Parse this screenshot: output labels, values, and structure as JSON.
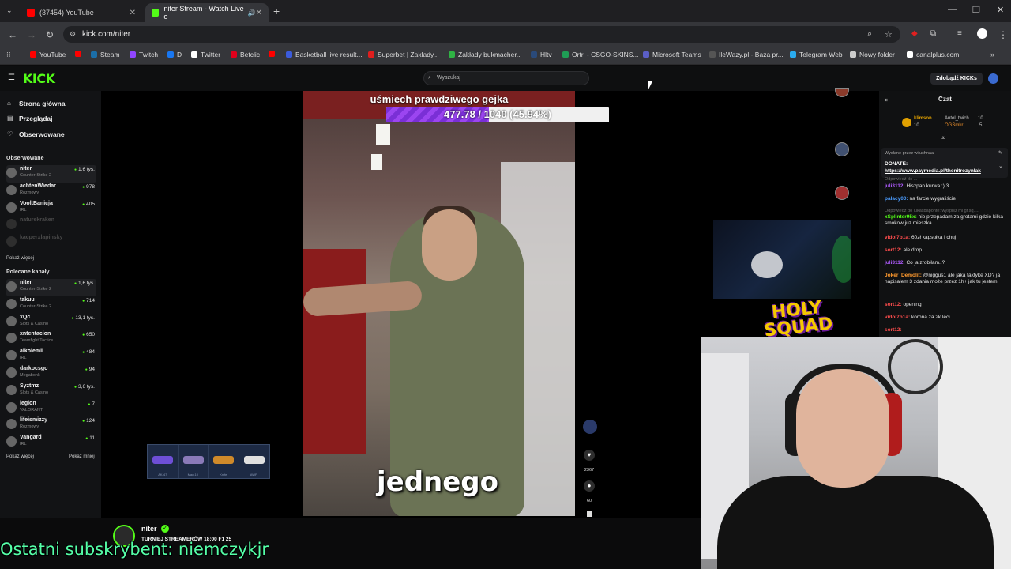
{
  "browser": {
    "tabs": [
      {
        "label": "(37454) YouTube",
        "color": "#ff0000"
      },
      {
        "label": "niter Stream - Watch Live o",
        "color": "#53fc18"
      }
    ],
    "url": "kick.com/niter",
    "bookmarks": [
      {
        "label": "YouTube",
        "color": "#ff0000"
      },
      {
        "label": "",
        "color": "#ff0000"
      },
      {
        "label": "Steam",
        "color": "#1b6ea8"
      },
      {
        "label": "Twitch",
        "color": "#9146ff"
      },
      {
        "label": "D",
        "color": "#1877f2"
      },
      {
        "label": "Twitter",
        "color": "#ffffff"
      },
      {
        "label": "Betclic",
        "color": "#e0001b"
      },
      {
        "label": "",
        "color": "#ff0000"
      },
      {
        "label": "Basketball live result...",
        "color": "#3b5bdb"
      },
      {
        "label": "Superbet | Zakłady...",
        "color": "#e01e1e"
      },
      {
        "label": "Zakłady bukmacher...",
        "color": "#2fb344"
      },
      {
        "label": "Hltv",
        "color": "#2a4a7a"
      },
      {
        "label": "Ortri - CSGO-SKINS...",
        "color": "#1f9d55"
      },
      {
        "label": "Microsoft Teams",
        "color": "#5b5fc7"
      },
      {
        "label": "IleWazy.pl - Baza pr...",
        "color": "#555555"
      },
      {
        "label": "Telegram Web",
        "color": "#2aabee"
      },
      {
        "label": "Nowy folder",
        "color": "#cccccc"
      },
      {
        "label": "canalplus.com",
        "color": "#ffffff"
      }
    ]
  },
  "kick": {
    "logo": "KICK",
    "search_placeholder": "Wyszukaj",
    "get_kicks": "Zdobądź KICKs"
  },
  "sidebar": {
    "nav": [
      "Strona główna",
      "Przeglądaj",
      "Obserwowane"
    ],
    "followed_header": "Obserwowane",
    "followed": [
      {
        "name": "niter",
        "category": "Counter-Strike 2",
        "viewers": "1,6 tys.",
        "selected": true,
        "online": true
      },
      {
        "name": "achtenWiedar",
        "category": "Rozmowy",
        "viewers": "978",
        "online": true
      },
      {
        "name": "VooltBanicja",
        "category": "IRL",
        "viewers": "405",
        "online": true
      },
      {
        "name": "naturekraken",
        "category": "",
        "viewers": "",
        "online": false
      },
      {
        "name": "kacperxlapinsky",
        "category": "",
        "viewers": "",
        "online": false
      }
    ],
    "show_more_1": "Pokaż więcej",
    "recommended_header": "Polecane kanały",
    "recommended": [
      {
        "name": "niter",
        "category": "Counter-Strike 2",
        "viewers": "1,6 tys.",
        "selected": true
      },
      {
        "name": "takuu",
        "category": "Counter-Strike 2",
        "viewers": "714"
      },
      {
        "name": "xQc",
        "category": "Slots & Casino",
        "viewers": "13,1 tys."
      },
      {
        "name": "xntentacion",
        "category": "Teamfight Tactics",
        "viewers": "650"
      },
      {
        "name": "alkoiemil",
        "category": "IRL",
        "viewers": "484"
      },
      {
        "name": "darkocsgo",
        "category": "Megabonk",
        "viewers": "94"
      },
      {
        "name": "Syztmz",
        "category": "Slots & Casino",
        "viewers": "3,6 tys."
      },
      {
        "name": "legion",
        "category": "VALORANT",
        "viewers": "7"
      },
      {
        "name": "lifeismizzy",
        "category": "Rozmowy",
        "viewers": "124"
      },
      {
        "name": "Vangard",
        "category": "IRL",
        "viewers": "11"
      }
    ],
    "show_more_2": "Pokaż więcej",
    "show_less": "Pokaż mniej"
  },
  "stream": {
    "goal_title": "uśmiech prawdziwego gejka",
    "goal_text": "477.78 / 1040 (45.94%)",
    "goal_fraction": 0.4594,
    "caption": "jednego",
    "likes": "2367",
    "comments": "60",
    "case_items": [
      {
        "label": "AK-47",
        "color": "#6e4fd6"
      },
      {
        "label": "Mac-10",
        "color": "#8a7ab8"
      },
      {
        "label": "Knife",
        "color": "#d08a2a"
      },
      {
        "label": "AWP",
        "color": "#e0e0e0"
      }
    ],
    "overlay_logo": "HOLY SQUAD"
  },
  "chat": {
    "title": "Czat",
    "top_supporters": [
      {
        "name": "klimson",
        "value": "10"
      },
      {
        "name": "Antol_twich",
        "value": "10"
      },
      {
        "name": "OGSmkr",
        "value": "5"
      }
    ],
    "pinned_sender": "Wysłane przez wiluchnaa",
    "pinned_text": "DONATE:",
    "pinned_link": "https://www.paymedia.pl/thenitrozynlak",
    "messages": [
      {
        "user": "",
        "text": "Odpowiedź do ...",
        "color": "#6e6e6e",
        "dim": true
      },
      {
        "user": "juli3112:",
        "text": "Hiszpan kurwa :) 3",
        "color": "#b05cff"
      },
      {
        "user": "palacy00:",
        "text": "na farcie wygraliście",
        "color": "#4a9cff"
      },
      {
        "user": "",
        "text": "Odpowiedź do lukasbaponte: wyśpisz mi gr.sq.l...",
        "color": "#6e6e6e",
        "dim": true
      },
      {
        "user": "xSplinter95x:",
        "text": "nie przepadam za grotami gdzie kilka smokow juz mieszka",
        "color": "#53fc18"
      },
      {
        "user": "vidol7b1a:",
        "text": "60zł kapsułka i chuj",
        "color": "#ff4d4d"
      },
      {
        "user": "sort12:",
        "text": "ale drop",
        "color": "#ff4d4d"
      },
      {
        "user": "juli3112:",
        "text": "Co ja zrobiłam..?",
        "color": "#b05cff"
      },
      {
        "user": "Joker_Demolit:",
        "text": "@niggus1 ale jaka taktyke XD? ja napisalem 3 zdania może przez 1h+ jak tu jestem",
        "color": "#ff9a2e"
      },
      {
        "user": "sort12:",
        "text": "opening",
        "color": "#ff4d4d"
      },
      {
        "user": "vidol7b1a:",
        "text": "korona za 2k leci",
        "color": "#ff4d4d"
      },
      {
        "user": "sort12:",
        "text": "",
        "color": "#ff4d4d"
      }
    ]
  },
  "bottom": {
    "streamer": "niter",
    "title": "TURNIEJ STREAMERÓW 18:00 F1 25",
    "last_sub": "Ostatni subskrybent: niemczykjr"
  },
  "colors": {
    "kick_green": "#53fc18",
    "goal_purple": "#8a3ae6",
    "last_sub": "#55ffa8"
  }
}
